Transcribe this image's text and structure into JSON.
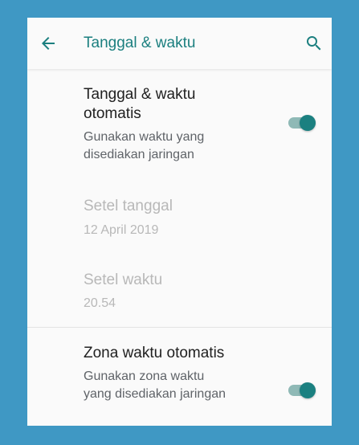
{
  "appbar": {
    "title": "Tanggal & waktu",
    "back_icon": "arrow-back-icon",
    "search_icon": "search-icon"
  },
  "settings": [
    {
      "label_line1": "Tanggal & waktu",
      "label_line2": "otomatis",
      "summary_line1": "Gunakan waktu yang",
      "summary_line2": "disediakan jaringan",
      "enabled": true,
      "checked": true
    },
    {
      "label": "Setel tanggal",
      "summary": "12 April 2019",
      "enabled": false
    },
    {
      "label": "Setel waktu",
      "summary": "20.54",
      "enabled": false
    },
    {
      "label": "Zona waktu otomatis",
      "summary_line1": "Gunakan zona waktu",
      "summary_line2": "yang disediakan jaringan",
      "enabled": true,
      "checked": true
    }
  ],
  "colors": {
    "background": "#3f98c4",
    "accent": "#1b8080",
    "toggle_track": "#8fb9b6",
    "disabled_text": "#b8b8b8"
  }
}
